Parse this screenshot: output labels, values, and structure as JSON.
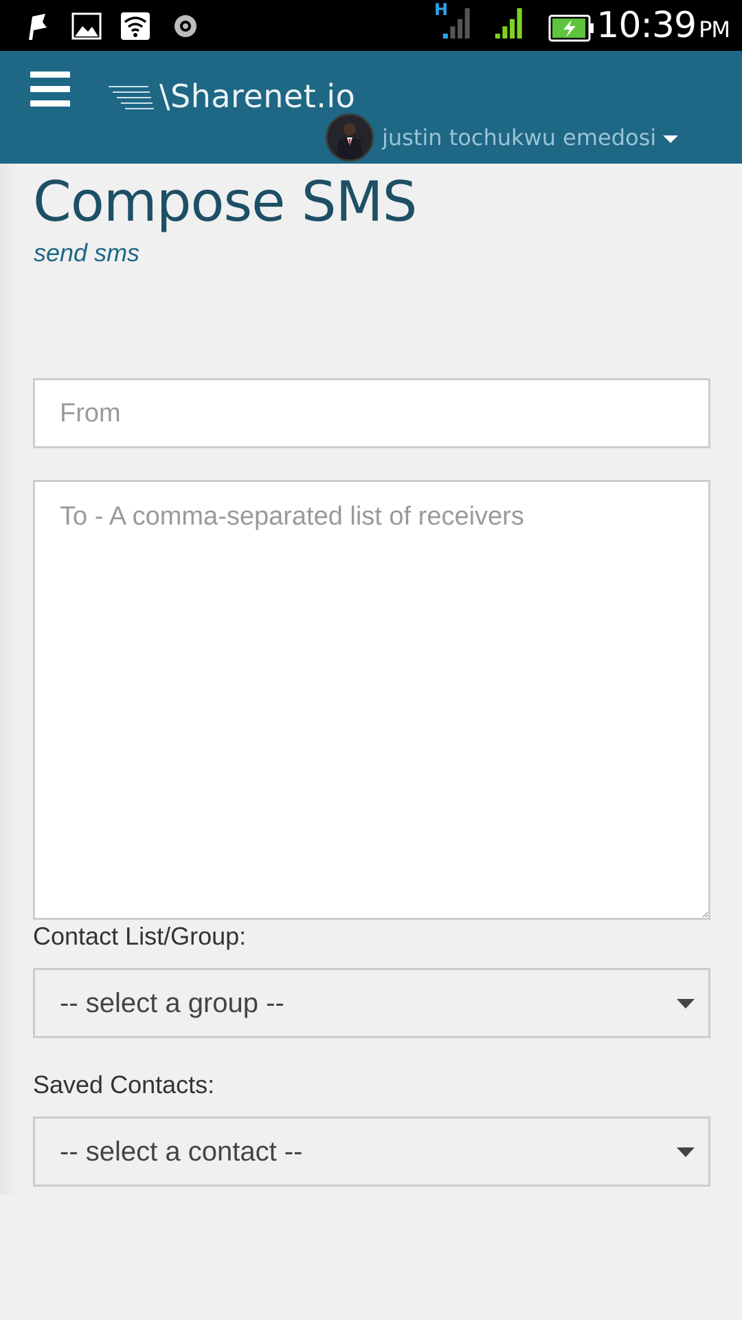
{
  "status_bar": {
    "time": "10:39",
    "ampm": "PM",
    "network_type": "H",
    "icons": [
      "notification-flag-icon",
      "gallery-icon",
      "wifi-icon",
      "media-icon",
      "signal-icon",
      "signal-icon",
      "battery-charging-icon"
    ]
  },
  "header": {
    "menu_icon": "hamburger-menu-icon",
    "logo_text": "\\Sharenet.io",
    "user_name": "justin tochukwu emedosi",
    "brand_color": "#1e6785"
  },
  "page": {
    "title": "Compose SMS",
    "subtitle": "send sms"
  },
  "form": {
    "from_placeholder": "From",
    "to_placeholder": "To - A comma-separated list of receivers",
    "contact_group_label": "Contact List/Group:",
    "contact_group_selected": "-- select a group --",
    "saved_contacts_label": "Saved Contacts:",
    "saved_contacts_selected": "-- select a contact --"
  }
}
